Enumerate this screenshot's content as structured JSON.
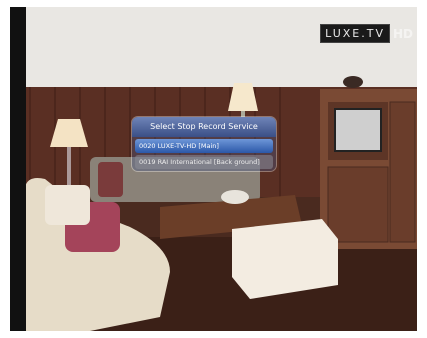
{
  "watermark": {
    "logo": "LUXE.TV",
    "hd": "HD"
  },
  "dialog": {
    "title": "Select Stop Record Service",
    "services": [
      {
        "label": "0020 LUXE-TV-HD [Main]",
        "selected": true
      },
      {
        "label": "0019 RAI International [Back ground]",
        "selected": false
      }
    ]
  },
  "colors": {
    "dialog_title": "#4a5f99",
    "selected_row": "#3f6cc0"
  }
}
